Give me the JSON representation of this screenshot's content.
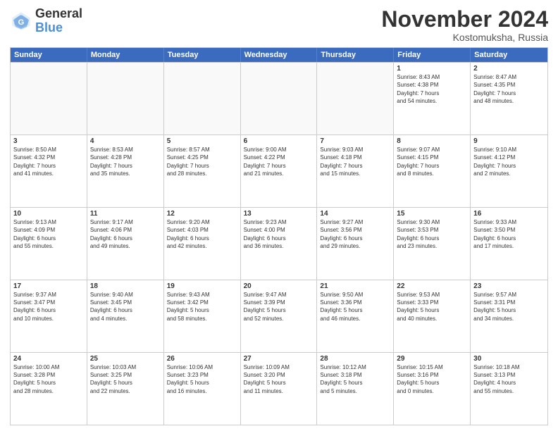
{
  "header": {
    "logo_line1": "General",
    "logo_line2": "Blue",
    "month_title": "November 2024",
    "location": "Kostomuksha, Russia"
  },
  "days_of_week": [
    "Sunday",
    "Monday",
    "Tuesday",
    "Wednesday",
    "Thursday",
    "Friday",
    "Saturday"
  ],
  "weeks": [
    [
      {
        "day": "",
        "info": ""
      },
      {
        "day": "",
        "info": ""
      },
      {
        "day": "",
        "info": ""
      },
      {
        "day": "",
        "info": ""
      },
      {
        "day": "",
        "info": ""
      },
      {
        "day": "1",
        "info": "Sunrise: 8:43 AM\nSunset: 4:38 PM\nDaylight: 7 hours\nand 54 minutes."
      },
      {
        "day": "2",
        "info": "Sunrise: 8:47 AM\nSunset: 4:35 PM\nDaylight: 7 hours\nand 48 minutes."
      }
    ],
    [
      {
        "day": "3",
        "info": "Sunrise: 8:50 AM\nSunset: 4:32 PM\nDaylight: 7 hours\nand 41 minutes."
      },
      {
        "day": "4",
        "info": "Sunrise: 8:53 AM\nSunset: 4:28 PM\nDaylight: 7 hours\nand 35 minutes."
      },
      {
        "day": "5",
        "info": "Sunrise: 8:57 AM\nSunset: 4:25 PM\nDaylight: 7 hours\nand 28 minutes."
      },
      {
        "day": "6",
        "info": "Sunrise: 9:00 AM\nSunset: 4:22 PM\nDaylight: 7 hours\nand 21 minutes."
      },
      {
        "day": "7",
        "info": "Sunrise: 9:03 AM\nSunset: 4:18 PM\nDaylight: 7 hours\nand 15 minutes."
      },
      {
        "day": "8",
        "info": "Sunrise: 9:07 AM\nSunset: 4:15 PM\nDaylight: 7 hours\nand 8 minutes."
      },
      {
        "day": "9",
        "info": "Sunrise: 9:10 AM\nSunset: 4:12 PM\nDaylight: 7 hours\nand 2 minutes."
      }
    ],
    [
      {
        "day": "10",
        "info": "Sunrise: 9:13 AM\nSunset: 4:09 PM\nDaylight: 6 hours\nand 55 minutes."
      },
      {
        "day": "11",
        "info": "Sunrise: 9:17 AM\nSunset: 4:06 PM\nDaylight: 6 hours\nand 49 minutes."
      },
      {
        "day": "12",
        "info": "Sunrise: 9:20 AM\nSunset: 4:03 PM\nDaylight: 6 hours\nand 42 minutes."
      },
      {
        "day": "13",
        "info": "Sunrise: 9:23 AM\nSunset: 4:00 PM\nDaylight: 6 hours\nand 36 minutes."
      },
      {
        "day": "14",
        "info": "Sunrise: 9:27 AM\nSunset: 3:56 PM\nDaylight: 6 hours\nand 29 minutes."
      },
      {
        "day": "15",
        "info": "Sunrise: 9:30 AM\nSunset: 3:53 PM\nDaylight: 6 hours\nand 23 minutes."
      },
      {
        "day": "16",
        "info": "Sunrise: 9:33 AM\nSunset: 3:50 PM\nDaylight: 6 hours\nand 17 minutes."
      }
    ],
    [
      {
        "day": "17",
        "info": "Sunrise: 9:37 AM\nSunset: 3:47 PM\nDaylight: 6 hours\nand 10 minutes."
      },
      {
        "day": "18",
        "info": "Sunrise: 9:40 AM\nSunset: 3:45 PM\nDaylight: 6 hours\nand 4 minutes."
      },
      {
        "day": "19",
        "info": "Sunrise: 9:43 AM\nSunset: 3:42 PM\nDaylight: 5 hours\nand 58 minutes."
      },
      {
        "day": "20",
        "info": "Sunrise: 9:47 AM\nSunset: 3:39 PM\nDaylight: 5 hours\nand 52 minutes."
      },
      {
        "day": "21",
        "info": "Sunrise: 9:50 AM\nSunset: 3:36 PM\nDaylight: 5 hours\nand 46 minutes."
      },
      {
        "day": "22",
        "info": "Sunrise: 9:53 AM\nSunset: 3:33 PM\nDaylight: 5 hours\nand 40 minutes."
      },
      {
        "day": "23",
        "info": "Sunrise: 9:57 AM\nSunset: 3:31 PM\nDaylight: 5 hours\nand 34 minutes."
      }
    ],
    [
      {
        "day": "24",
        "info": "Sunrise: 10:00 AM\nSunset: 3:28 PM\nDaylight: 5 hours\nand 28 minutes."
      },
      {
        "day": "25",
        "info": "Sunrise: 10:03 AM\nSunset: 3:25 PM\nDaylight: 5 hours\nand 22 minutes."
      },
      {
        "day": "26",
        "info": "Sunrise: 10:06 AM\nSunset: 3:23 PM\nDaylight: 5 hours\nand 16 minutes."
      },
      {
        "day": "27",
        "info": "Sunrise: 10:09 AM\nSunset: 3:20 PM\nDaylight: 5 hours\nand 11 minutes."
      },
      {
        "day": "28",
        "info": "Sunrise: 10:12 AM\nSunset: 3:18 PM\nDaylight: 5 hours\nand 5 minutes."
      },
      {
        "day": "29",
        "info": "Sunrise: 10:15 AM\nSunset: 3:16 PM\nDaylight: 5 hours\nand 0 minutes."
      },
      {
        "day": "30",
        "info": "Sunrise: 10:18 AM\nSunset: 3:13 PM\nDaylight: 4 hours\nand 55 minutes."
      }
    ]
  ]
}
